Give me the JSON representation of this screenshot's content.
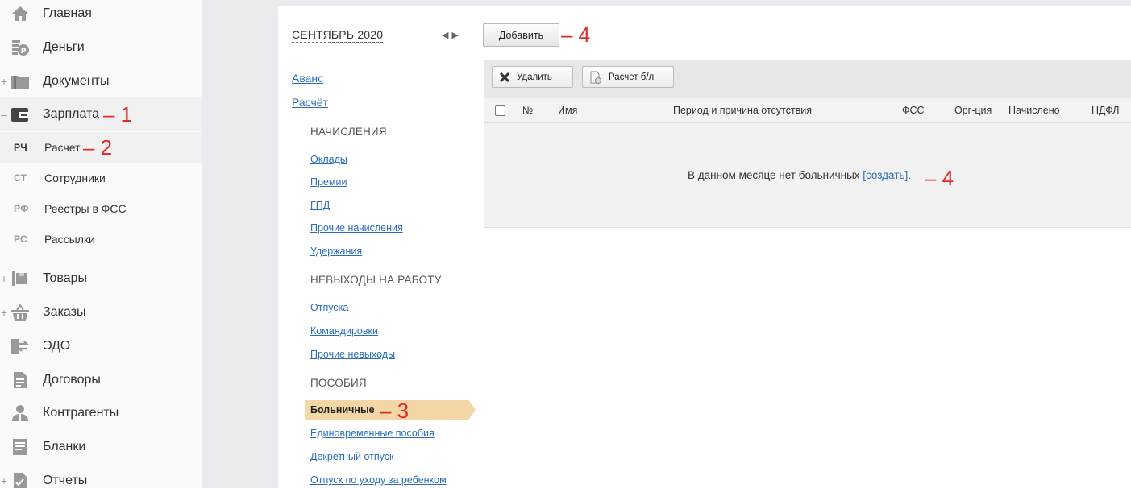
{
  "sidebar": {
    "items": [
      {
        "label": "Главная",
        "icon": "home-icon",
        "expandable": false
      },
      {
        "label": "Деньги",
        "icon": "money-icon",
        "expandable": false
      },
      {
        "label": "Документы",
        "icon": "folder-icon",
        "expandable": true
      },
      {
        "label": "Зарплата",
        "icon": "wallet-icon",
        "expandable": true,
        "expanded": true
      },
      {
        "label": "Товары",
        "icon": "box-icon",
        "expandable": true
      },
      {
        "label": "Заказы",
        "icon": "basket-icon",
        "expandable": true
      },
      {
        "label": "ЭДО",
        "icon": "edo-icon",
        "expandable": false
      },
      {
        "label": "Договоры",
        "icon": "contract-icon",
        "expandable": false
      },
      {
        "label": "Контрагенты",
        "icon": "person-icon",
        "expandable": false
      },
      {
        "label": "Бланки",
        "icon": "form-icon",
        "expandable": false
      },
      {
        "label": "Отчеты",
        "icon": "report-icon",
        "expandable": true
      }
    ],
    "subitems": [
      {
        "abbr": "РЧ",
        "label": "Расчет"
      },
      {
        "abbr": "СТ",
        "label": "Сотрудники"
      },
      {
        "abbr": "РФ",
        "label": "Реестры в ФСС"
      },
      {
        "abbr": "РС",
        "label": "Рассылки"
      }
    ],
    "plus": "+",
    "minus": "–"
  },
  "annotations": {
    "m1": "– 1",
    "m2": "– 2",
    "m3": "– 3",
    "m4a": "– 4",
    "m4b": "– 4"
  },
  "calc": {
    "period": "СЕНТЯБРЬ 2020",
    "prev_arrow": "◀",
    "next_arrow": "▶",
    "links": [
      "Аванс",
      "Расчёт"
    ],
    "sections": [
      {
        "title": "НАЧИСЛЕНИЯ",
        "items": [
          "Оклады",
          "Премии",
          "ГПД",
          "Прочие начисления",
          "Удержания"
        ]
      },
      {
        "title": "НЕВЫХОДЫ НА РАБОТУ",
        "items": [
          "Отпуска",
          "Командировки",
          "Прочие невыходы"
        ]
      },
      {
        "title": "ПОСОБИЯ",
        "items": [
          "Больничные",
          "Единовременные пособия",
          "Декретный отпуск",
          "Отпуск по уходу за ребенком"
        ]
      }
    ],
    "selected": "Больничные",
    "add_button": "Добавить"
  },
  "toolbar": {
    "delete_label": "Удалить",
    "calc_label": "Расчет б/л"
  },
  "table": {
    "columns": [
      "№",
      "Имя",
      "Период и причина отсутствия",
      "ФСС",
      "Орг-ция",
      "Начислено",
      "НДФЛ"
    ],
    "empty_text": "В данном месяце нет больничных ",
    "create_link": "[создать]",
    "period_after": "."
  }
}
